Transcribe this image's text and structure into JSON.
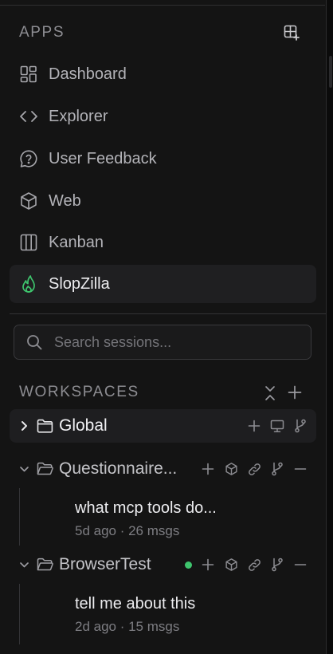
{
  "apps": {
    "heading": "APPS",
    "add_icon": "grid-plus-icon",
    "items": [
      {
        "label": "Dashboard",
        "icon": "dashboard-icon"
      },
      {
        "label": "Explorer",
        "icon": "code-icon"
      },
      {
        "label": "User Feedback",
        "icon": "question-bubble-icon"
      },
      {
        "label": "Web",
        "icon": "cube-icon"
      },
      {
        "label": "Kanban",
        "icon": "kanban-icon"
      },
      {
        "label": "SlopZilla",
        "icon": "flame-icon",
        "active": true
      }
    ]
  },
  "search": {
    "placeholder": "Search sessions..."
  },
  "workspaces": {
    "heading": "WORKSPACES",
    "items": [
      {
        "name": "Global",
        "expanded": false
      },
      {
        "name": "Questionnaire...",
        "expanded": true,
        "sessions": [
          {
            "title": "what mcp tools do...",
            "meta": "5d ago · 26 msgs"
          }
        ]
      },
      {
        "name": "BrowserTest",
        "expanded": true,
        "status_color": "#3ec46d",
        "sessions": [
          {
            "title": "tell me about this",
            "meta": "2d ago · 15 msgs"
          }
        ]
      }
    ]
  },
  "colors": {
    "accent_green": "#3ec46d",
    "background": "#141414"
  }
}
